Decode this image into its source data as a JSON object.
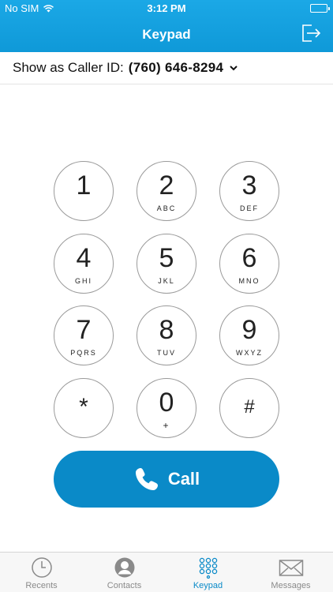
{
  "status_bar": {
    "carrier": "No SIM",
    "time": "3:12 PM"
  },
  "nav": {
    "title": "Keypad",
    "right_icon": "sign-out-icon"
  },
  "caller_id": {
    "label": "Show as Caller ID:",
    "number": "(760) 646-8294"
  },
  "keypad": {
    "keys": [
      {
        "digit": "1",
        "letters": ""
      },
      {
        "digit": "2",
        "letters": "ABC"
      },
      {
        "digit": "3",
        "letters": "DEF"
      },
      {
        "digit": "4",
        "letters": "GHI"
      },
      {
        "digit": "5",
        "letters": "JKL"
      },
      {
        "digit": "6",
        "letters": "MNO"
      },
      {
        "digit": "7",
        "letters": "PQRS"
      },
      {
        "digit": "8",
        "letters": "TUV"
      },
      {
        "digit": "9",
        "letters": "WXYZ"
      },
      {
        "digit": "*",
        "letters": ""
      },
      {
        "digit": "0",
        "letters": "+"
      },
      {
        "digit": "#",
        "letters": ""
      }
    ]
  },
  "call_button": {
    "label": "Call",
    "icon": "phone-icon"
  },
  "tab_bar": {
    "tabs": [
      {
        "label": "Recents",
        "icon": "clock-icon",
        "active": false
      },
      {
        "label": "Contacts",
        "icon": "contact-avatar-icon",
        "active": false
      },
      {
        "label": "Keypad",
        "icon": "keypad-grid-icon",
        "active": true
      },
      {
        "label": "Messages",
        "icon": "envelope-icon",
        "active": false
      }
    ]
  },
  "colors": {
    "header_blue": "#1ba8e6",
    "accent_blue": "#0a8ac8",
    "inactive_gray": "#8a8a8a"
  }
}
